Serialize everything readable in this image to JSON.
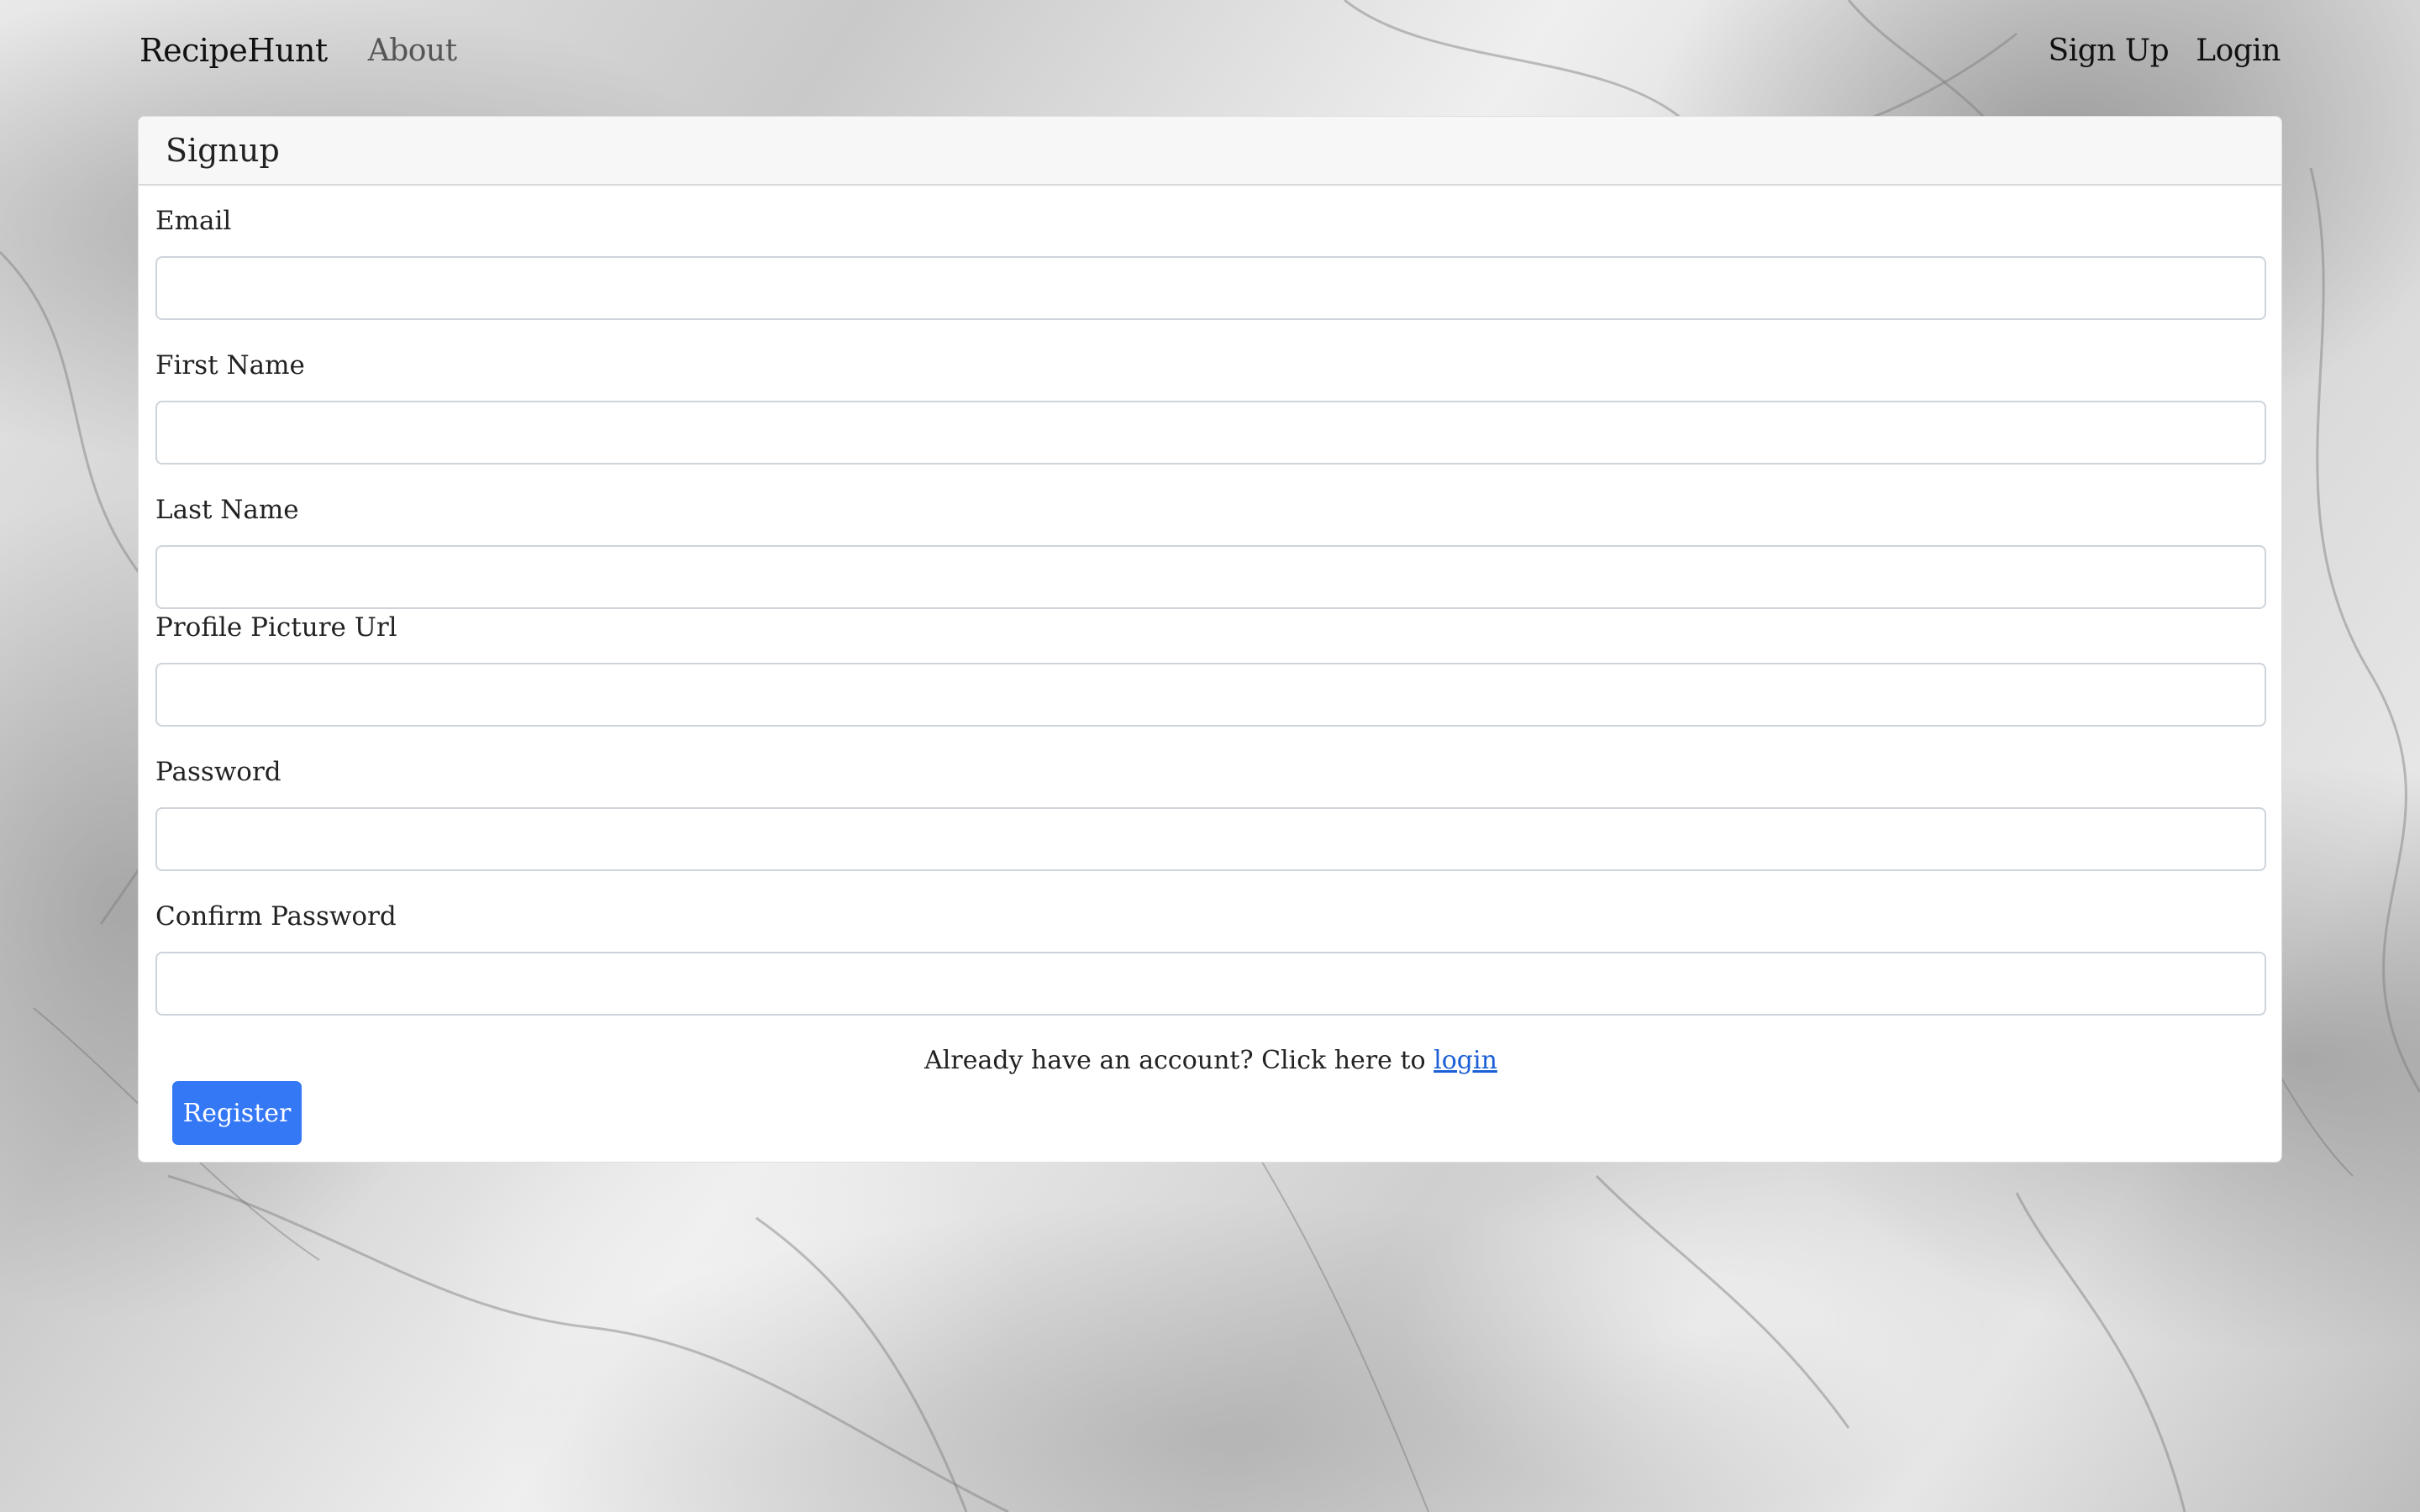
{
  "navbar": {
    "brand": "RecipeHunt",
    "links": {
      "about": "About",
      "sign_up": "Sign Up",
      "login": "Login"
    }
  },
  "signup_card": {
    "title": "Signup",
    "fields": {
      "email": {
        "label": "Email",
        "value": ""
      },
      "first_name": {
        "label": "First Name",
        "value": ""
      },
      "last_name": {
        "label": "Last Name",
        "value": ""
      },
      "profile_picture_url": {
        "label": "Profile Picture Url",
        "value": ""
      },
      "password": {
        "label": "Password",
        "value": ""
      },
      "confirm_password": {
        "label": "Confirm Password",
        "value": ""
      }
    },
    "already_text": "Already have an account? Click here to",
    "login_link": "login",
    "register_button": "Register"
  },
  "colors": {
    "primary_button": "#3478f6",
    "link": "#1a5fd6",
    "card_header_bg": "#f7f7f7"
  }
}
